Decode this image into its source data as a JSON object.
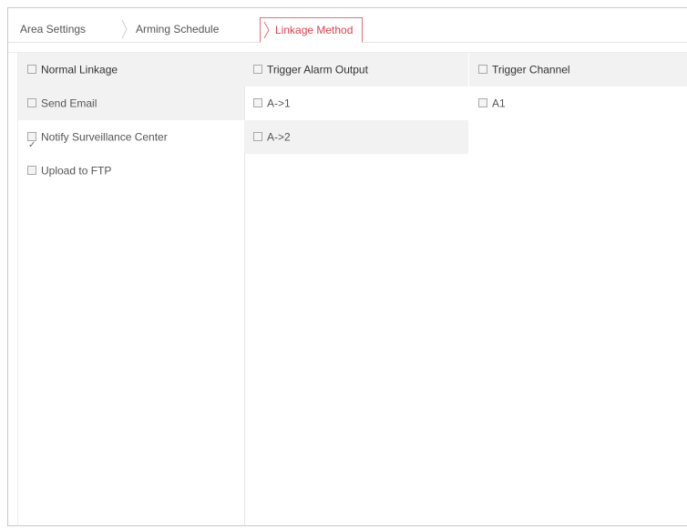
{
  "tabs": [
    {
      "label": "Area Settings",
      "active": false
    },
    {
      "label": "Arming Schedule",
      "active": false
    },
    {
      "label": "Linkage Method",
      "active": true
    }
  ],
  "colors": {
    "active_tab": "#d9434f",
    "active_border": "#e0727d"
  },
  "columns": {
    "normal": {
      "header": "Normal Linkage",
      "items": [
        {
          "label": "Send Email",
          "checked": false
        },
        {
          "label": "Notify Surveillance Center",
          "checked": true
        },
        {
          "label": "Upload to FTP",
          "checked": false
        }
      ]
    },
    "alarm_output": {
      "header": "Trigger Alarm Output",
      "items": [
        {
          "label": "A->1",
          "checked": false
        },
        {
          "label": "A->2",
          "checked": false
        }
      ]
    },
    "channel": {
      "header": "Trigger Channel",
      "items": [
        {
          "label": "A1",
          "checked": false
        }
      ]
    }
  }
}
